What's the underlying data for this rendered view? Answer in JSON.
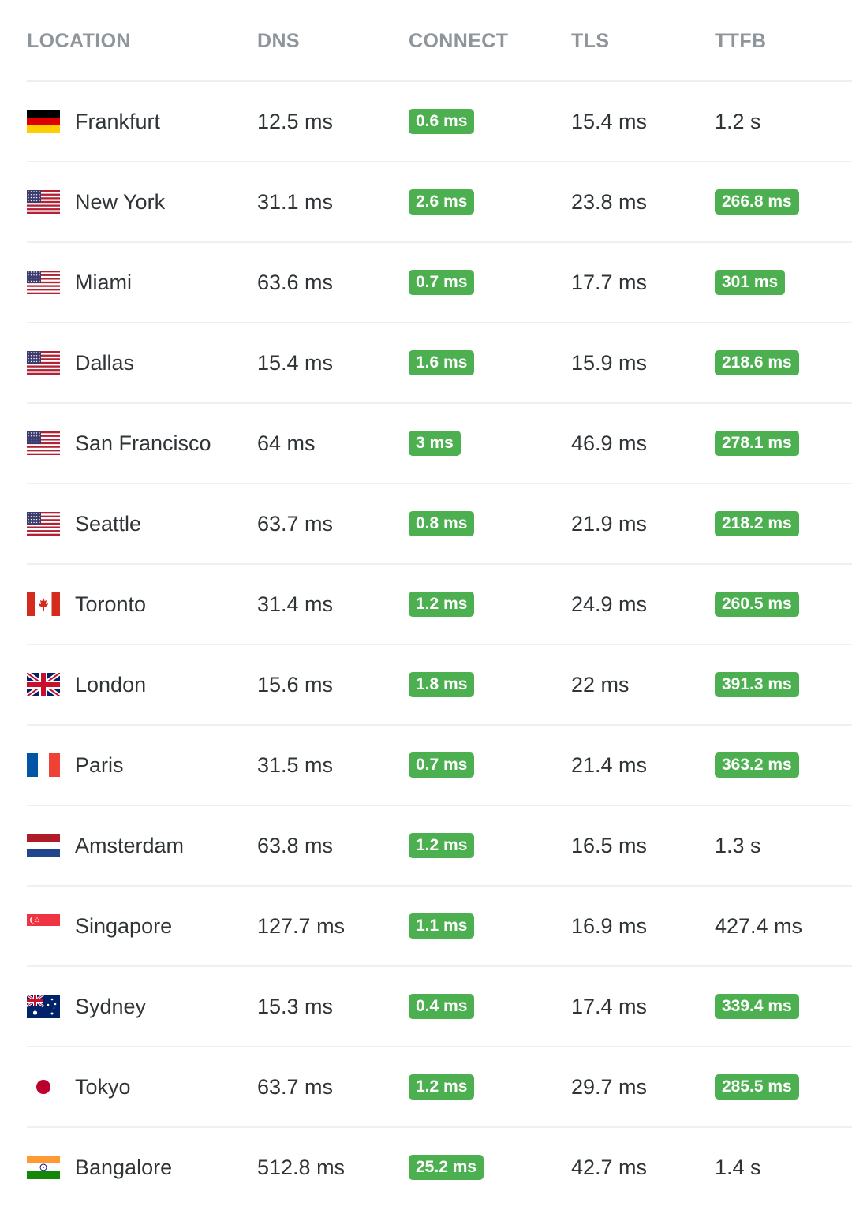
{
  "headers": {
    "location": "LOCATION",
    "dns": "DNS",
    "connect": "CONNECT",
    "tls": "TLS",
    "ttfb": "TTFB"
  },
  "colors": {
    "badge_green": "#4caf50",
    "header_text": "#8e959b",
    "body_text": "#2f3437"
  },
  "rows": [
    {
      "location": "Frankfurt",
      "flag": "germany-flag-icon",
      "dns": "12.5 ms",
      "connect": "0.6 ms",
      "connect_badge": true,
      "tls": "15.4 ms",
      "ttfb": "1.2 s",
      "ttfb_badge": false
    },
    {
      "location": "New York",
      "flag": "usa-flag-icon",
      "dns": "31.1 ms",
      "connect": "2.6 ms",
      "connect_badge": true,
      "tls": "23.8 ms",
      "ttfb": "266.8 ms",
      "ttfb_badge": true
    },
    {
      "location": "Miami",
      "flag": "usa-flag-icon",
      "dns": "63.6 ms",
      "connect": "0.7 ms",
      "connect_badge": true,
      "tls": "17.7 ms",
      "ttfb": "301 ms",
      "ttfb_badge": true
    },
    {
      "location": "Dallas",
      "flag": "usa-flag-icon",
      "dns": "15.4 ms",
      "connect": "1.6 ms",
      "connect_badge": true,
      "tls": "15.9 ms",
      "ttfb": "218.6 ms",
      "ttfb_badge": true
    },
    {
      "location": "San Francisco",
      "flag": "usa-flag-icon",
      "dns": "64 ms",
      "connect": "3 ms",
      "connect_badge": true,
      "tls": "46.9 ms",
      "ttfb": "278.1 ms",
      "ttfb_badge": true
    },
    {
      "location": "Seattle",
      "flag": "usa-flag-icon",
      "dns": "63.7 ms",
      "connect": "0.8 ms",
      "connect_badge": true,
      "tls": "21.9 ms",
      "ttfb": "218.2 ms",
      "ttfb_badge": true
    },
    {
      "location": "Toronto",
      "flag": "canada-flag-icon",
      "dns": "31.4 ms",
      "connect": "1.2 ms",
      "connect_badge": true,
      "tls": "24.9 ms",
      "ttfb": "260.5 ms",
      "ttfb_badge": true
    },
    {
      "location": "London",
      "flag": "uk-flag-icon",
      "dns": "15.6 ms",
      "connect": "1.8 ms",
      "connect_badge": true,
      "tls": "22 ms",
      "ttfb": "391.3 ms",
      "ttfb_badge": true
    },
    {
      "location": "Paris",
      "flag": "france-flag-icon",
      "dns": "31.5 ms",
      "connect": "0.7 ms",
      "connect_badge": true,
      "tls": "21.4 ms",
      "ttfb": "363.2 ms",
      "ttfb_badge": true
    },
    {
      "location": "Amsterdam",
      "flag": "netherlands-flag-icon",
      "dns": "63.8 ms",
      "connect": "1.2 ms",
      "connect_badge": true,
      "tls": "16.5 ms",
      "ttfb": "1.3 s",
      "ttfb_badge": false
    },
    {
      "location": "Singapore",
      "flag": "singapore-flag-icon",
      "dns": "127.7 ms",
      "connect": "1.1 ms",
      "connect_badge": true,
      "tls": "16.9 ms",
      "ttfb": "427.4 ms",
      "ttfb_badge": false
    },
    {
      "location": "Sydney",
      "flag": "australia-flag-icon",
      "dns": "15.3 ms",
      "connect": "0.4 ms",
      "connect_badge": true,
      "tls": "17.4 ms",
      "ttfb": "339.4 ms",
      "ttfb_badge": true
    },
    {
      "location": "Tokyo",
      "flag": "japan-flag-icon",
      "dns": "63.7 ms",
      "connect": "1.2 ms",
      "connect_badge": true,
      "tls": "29.7 ms",
      "ttfb": "285.5 ms",
      "ttfb_badge": true
    },
    {
      "location": "Bangalore",
      "flag": "india-flag-icon",
      "dns": "512.8 ms",
      "connect": "25.2 ms",
      "connect_badge": true,
      "tls": "42.7 ms",
      "ttfb": "1.4 s",
      "ttfb_badge": false
    }
  ]
}
